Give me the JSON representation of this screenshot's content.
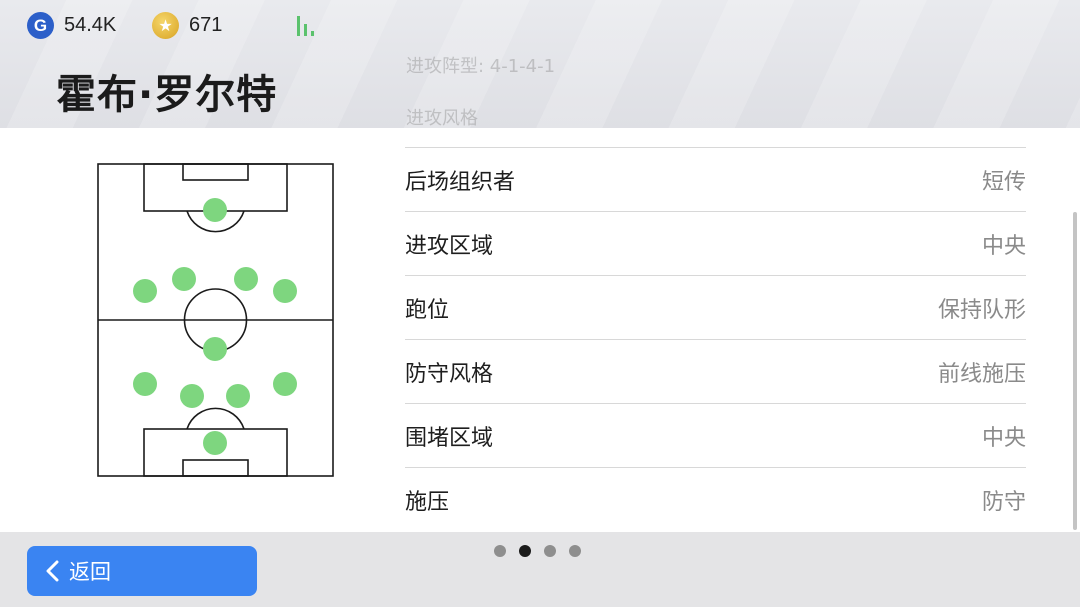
{
  "header": {
    "currency_g_symbol": "G",
    "currency_g_value": "54.4K",
    "currency_star_symbol": "★",
    "currency_star_value": "671",
    "team_name": "霍布·罗尔特",
    "faded_formation_text": "进攻阵型: 4-1-4-1",
    "faded_style_text": "进攻风格"
  },
  "formation": {
    "name": "4-1-4-1",
    "players": [
      {
        "role": "opponent-goalkeeper"
      },
      {
        "role": "opponent-midfielder-1"
      },
      {
        "role": "opponent-midfielder-2"
      },
      {
        "role": "opponent-midfielder-3"
      },
      {
        "role": "opponent-midfielder-4"
      },
      {
        "role": "centre-forward"
      },
      {
        "role": "wide-midfielder-left"
      },
      {
        "role": "central-midfielder-left"
      },
      {
        "role": "central-midfielder-right"
      },
      {
        "role": "wide-midfielder-right"
      },
      {
        "role": "goalkeeper"
      }
    ],
    "dot_color": "#7ed67f"
  },
  "tactics": [
    {
      "label": "后场组织者",
      "value": "短传"
    },
    {
      "label": "进攻区域",
      "value": "中央"
    },
    {
      "label": "跑位",
      "value": "保持队形"
    },
    {
      "label": "防守风格",
      "value": "前线施压"
    },
    {
      "label": "围堵区域",
      "value": "中央"
    },
    {
      "label": "施压",
      "value": "防守"
    }
  ],
  "footer": {
    "back_label": "返回",
    "page_count": 4,
    "active_page": 2
  },
  "colors": {
    "accent": "#3a84f2",
    "coin_g": "#2c5fc9",
    "coin_star": "#e1b238",
    "signal": "#5bc26d"
  }
}
